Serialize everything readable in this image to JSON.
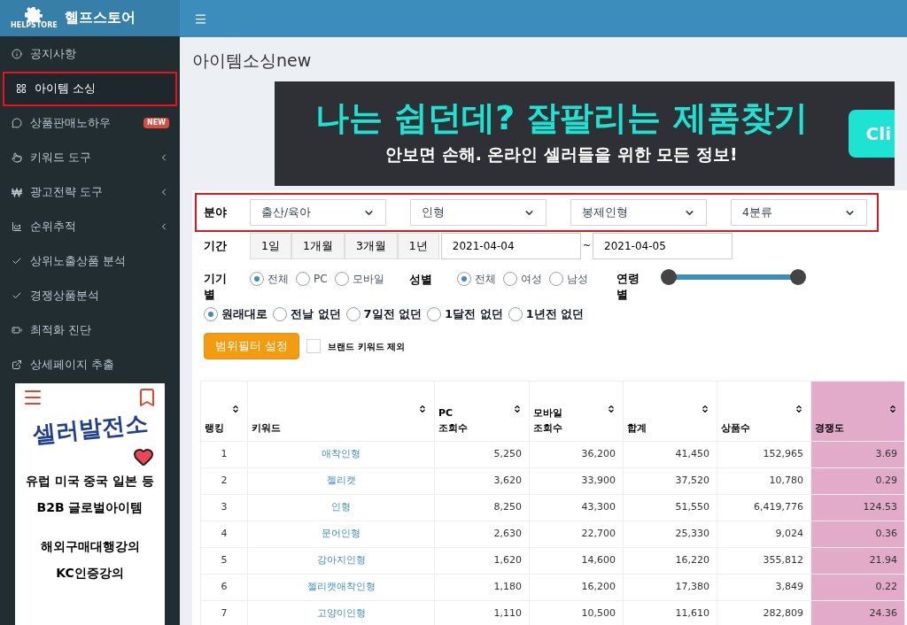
{
  "brand": {
    "name": "헬프스토어",
    "logo_text": "HELPSTORE"
  },
  "sidebar": {
    "items": [
      {
        "label": "공지사항",
        "selected": false,
        "expandable": false
      },
      {
        "label": "아이템 소싱",
        "selected": true,
        "expandable": false
      },
      {
        "label": "상품판매노하우",
        "selected": false,
        "expandable": false,
        "badge": "NEW"
      },
      {
        "label": "키워드 도구",
        "selected": false,
        "expandable": true
      },
      {
        "label": "광고전략 도구",
        "selected": false,
        "expandable": true
      },
      {
        "label": "순위추적",
        "selected": false,
        "expandable": true
      },
      {
        "label": "상위노출상품 분석",
        "selected": false,
        "expandable": false
      },
      {
        "label": "경쟁상품분석",
        "selected": false,
        "expandable": false
      },
      {
        "label": "최적화 진단",
        "selected": false,
        "expandable": false
      },
      {
        "label": "상세페이지 추출",
        "selected": false,
        "expandable": false
      }
    ],
    "ad": {
      "title": "셀러발전소",
      "groups": [
        [
          "유럽 미국 중국 일본 등",
          "B2B 글로벌아이템"
        ],
        [
          "해외구매대행강의",
          "KC인증강의"
        ]
      ]
    }
  },
  "page": {
    "title": "아이템소싱new"
  },
  "banner": {
    "headline": "나는 쉽던데? 잘팔리는 제품찾기",
    "subline": "안보면 손해. 온라인 셀러들을 위한 모든 정보!",
    "button": "Cli"
  },
  "filters": {
    "annotated": true,
    "category": {
      "label": "분야",
      "selects": [
        "출산/육아",
        "인형",
        "봉제인형",
        "4분류"
      ]
    },
    "period": {
      "label": "기간",
      "buttons": [
        "1일",
        "1개월",
        "3개월",
        "1년"
      ],
      "from": "2021-04-04",
      "separator": "~",
      "to": "2021-04-05"
    },
    "device": {
      "label": "기기별",
      "options": [
        {
          "label": "전체",
          "selected": true
        },
        {
          "label": "PC",
          "selected": false
        },
        {
          "label": "모바일",
          "selected": false
        }
      ]
    },
    "gender": {
      "label": "성별",
      "options": [
        {
          "label": "전체",
          "selected": true
        },
        {
          "label": "여성",
          "selected": false
        },
        {
          "label": "남성",
          "selected": false
        }
      ]
    },
    "age": {
      "label": "연령별",
      "thumbs": [
        {
          "level": 0
        },
        {
          "level": 1
        }
      ]
    },
    "freshness": [
      {
        "label": "원래대로",
        "selected": true
      },
      {
        "label": "전날 없던",
        "selected": false
      },
      {
        "label": "7일전 없던",
        "selected": false
      },
      {
        "label": "1달전 없던",
        "selected": false
      },
      {
        "label": "1년전 없던",
        "selected": false
      }
    ],
    "apply_button": "범위필터 설정",
    "exclude_brand": {
      "label": "브랜드 키워드 제외",
      "checked": false
    }
  },
  "table": {
    "columns": [
      {
        "label": "랭킹",
        "highlighted": false
      },
      {
        "label": "키워드",
        "highlighted": false
      },
      {
        "label": "PC 조회수",
        "highlighted": false
      },
      {
        "label": "모바일 조회수",
        "highlighted": false
      },
      {
        "label": "합계",
        "highlighted": false
      },
      {
        "label": "상품수",
        "highlighted": false
      },
      {
        "label": "경쟁도",
        "highlighted": true
      }
    ],
    "rows": [
      [
        "1",
        "애착인형",
        "5,250",
        "36,200",
        "41,450",
        "152,965",
        "3.69"
      ],
      [
        "2",
        "젤리캣",
        "3,620",
        "33,900",
        "37,520",
        "10,780",
        "0.29"
      ],
      [
        "3",
        "인형",
        "8,250",
        "43,300",
        "51,550",
        "6,419,776",
        "124.53"
      ],
      [
        "4",
        "문어인형",
        "2,630",
        "22,700",
        "25,330",
        "9,024",
        "0.36"
      ],
      [
        "5",
        "강아지인형",
        "1,620",
        "14,600",
        "16,220",
        "355,812",
        "21.94"
      ],
      [
        "6",
        "젤리캣애착인형",
        "1,180",
        "16,200",
        "17,380",
        "3,849",
        "0.22"
      ],
      [
        "7",
        "고양이인형",
        "1,110",
        "10,500",
        "11,610",
        "282,809",
        "24.36"
      ]
    ]
  }
}
